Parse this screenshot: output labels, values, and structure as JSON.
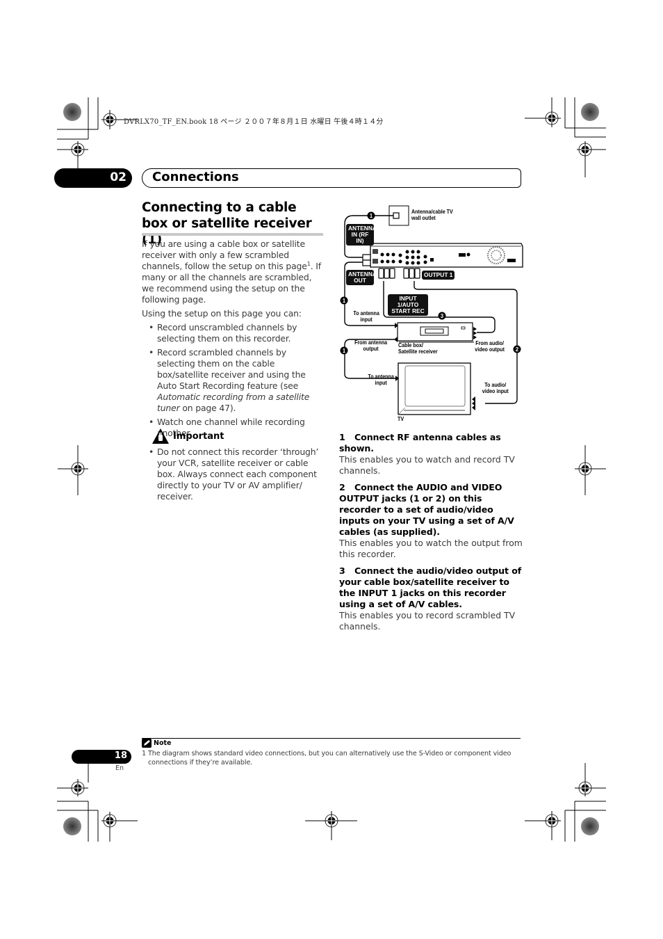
{
  "print_header": "DVRLX70_TF_EN.book  18 ページ  ２００７年８月１日  水曜日  午後４時１４分",
  "chapter": {
    "number": "02",
    "title": "Connections"
  },
  "section": {
    "title": "Connecting to a cable box or satellite receiver (1)"
  },
  "intro": {
    "paragraph_before_sup": "If you are using a cable box or satellite receiver with only a few scrambled channels, follow the setup on this page",
    "footnote_ref": "1",
    "paragraph_after_sup": ". If many or all the channels are scrambled, we recommend using the setup on the following page.",
    "lead": "Using the setup on this page you can:",
    "bullets": [
      {
        "text": "Record unscrambled channels by selecting them on this recorder."
      },
      {
        "text_before": "Record scrambled channels by selecting them on the cable box/satellite receiver and using the Auto Start Recording feature (see ",
        "italic": "Automatic recording from a satellite tuner",
        "text_after": " on page 47)."
      },
      {
        "text": "Watch one channel while recording another."
      }
    ]
  },
  "important": {
    "icon": "warning-hand-icon",
    "label": "Important",
    "bullets": [
      "Do not connect this recorder ‘through’ your VCR, satellite receiver or cable box. Always connect each component directly to your TV or AV amplifier/ receiver."
    ]
  },
  "diagram": {
    "labels": {
      "wall_outlet": "Antenna/cable TV wall outlet",
      "antenna_in": "ANTENNA IN (RF IN)",
      "antenna_out": "ANTENNA OUT",
      "output1": "OUTPUT 1",
      "input1": "INPUT 1/AUTO START REC",
      "to_antenna_input_1": "To antenna input",
      "from_antenna_output": "From antenna output",
      "cable_box": "Cable box/ Satellite receiver",
      "from_av_output": "From audio/ video output",
      "to_antenna_input_2": "To antenna input",
      "to_av_input": "To audio/ video input",
      "tv": "TV"
    },
    "step_markers": [
      "1",
      "1",
      "1",
      "2",
      "3"
    ]
  },
  "steps": [
    {
      "number": "1",
      "heading": "Connect RF antenna cables as shown.",
      "body": "This enables you to watch and record TV channels."
    },
    {
      "number": "2",
      "heading": "Connect the AUDIO and VIDEO OUTPUT jacks (1 or 2) on this recorder to a set of audio/video inputs on your TV using a set of A/V cables (as supplied).",
      "body": "This enables you to watch the output from this recorder."
    },
    {
      "number": "3",
      "heading": "Connect the audio/video output of your cable box/satellite receiver to the INPUT 1 jacks on this recorder using a set of A/V cables.",
      "body": "This enables you to record scrambled TV channels."
    }
  ],
  "note": {
    "icon": "pencil-note-icon",
    "label": "Note",
    "footnotes": [
      {
        "number": "1",
        "text": "The diagram shows standard video connections, but you can alternatively use the S-Video or component video connections if they’re available."
      }
    ]
  },
  "page": {
    "number": "18",
    "language": "En"
  }
}
